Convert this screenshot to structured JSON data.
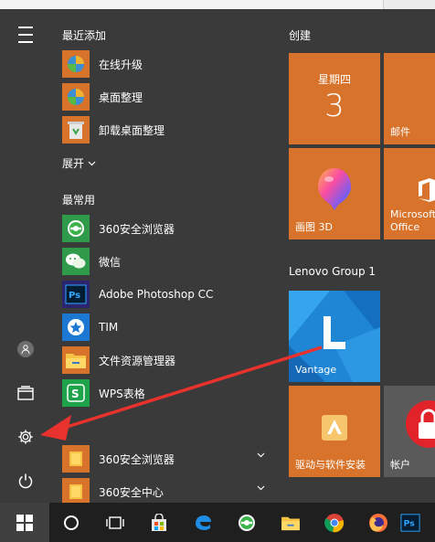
{
  "recent_header": "最近添加",
  "recent_apps": [
    {
      "label": "在线升级"
    },
    {
      "label": "桌面整理"
    },
    {
      "label": "卸载桌面整理"
    }
  ],
  "expand_label": "展开",
  "frequent_header": "最常用",
  "frequent_apps": [
    {
      "label": "360安全浏览器"
    },
    {
      "label": "微信"
    },
    {
      "label": "Adobe Photoshop CC"
    },
    {
      "label": "TIM"
    },
    {
      "label": "文件资源管理器"
    },
    {
      "label": "WPS表格"
    }
  ],
  "folder_apps": [
    {
      "label": "360安全浏览器"
    },
    {
      "label": "360安全中心"
    }
  ],
  "tile_groups": {
    "create": "创建",
    "lenovo": "Lenovo Group 1"
  },
  "tiles": {
    "calendar_day": "星期四",
    "calendar_date": "3",
    "mail": "邮件",
    "paint3d": "画图 3D",
    "office": "Microsoft Office",
    "office_line1": "Microsoft",
    "office_line2": "Office",
    "vantage": "Vantage",
    "driver": "驱动与软件安装",
    "account": "帐户"
  },
  "icons": {
    "menu": "hamburger-icon",
    "user": "user-icon",
    "documents": "documents-icon",
    "settings": "gear-icon",
    "power": "power-icon"
  },
  "colors": {
    "tile_orange": "#d7732a",
    "start_bg": "#3a3a3a",
    "taskbar_bg": "#1f1f1f",
    "arrow_red": "#e8322d"
  }
}
